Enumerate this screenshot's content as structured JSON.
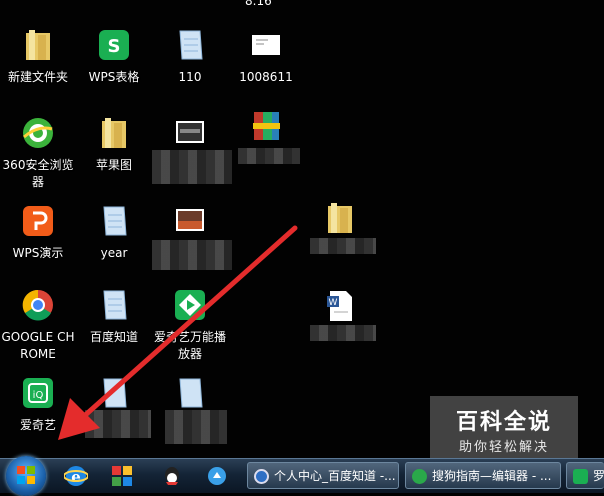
{
  "desktop": {
    "top_partial_label": "8.16",
    "icons": [
      {
        "label": "新建文件夹",
        "icon": "folder-icon"
      },
      {
        "label": "WPS表格",
        "icon": "wps-spreadsheet-icon"
      },
      {
        "label": "110",
        "icon": "notepad-icon"
      },
      {
        "label": "1008611",
        "icon": "document-icon"
      },
      {
        "label": "360安全浏览器",
        "icon": "browser-360-icon"
      },
      {
        "label": "苹果图",
        "icon": "folder-icon"
      },
      {
        "label": "WPS演示",
        "icon": "wps-presentation-icon"
      },
      {
        "label": "year",
        "icon": "notepad-icon"
      },
      {
        "label": "GOOGLE CHROME",
        "icon": "chrome-icon"
      },
      {
        "label": "百度知道",
        "icon": "notepad-icon"
      },
      {
        "label": "爱奇艺万能播放器",
        "icon": "iqiyi-player-icon"
      },
      {
        "label": "爱奇艺",
        "icon": "iqiyi-icon"
      }
    ]
  },
  "taskbar": {
    "tasks": [
      {
        "label": "个人中心_百度知道 -..."
      },
      {
        "label": "搜狗指南—编辑器 - ..."
      },
      {
        "label": "罗"
      }
    ]
  },
  "watermark": {
    "title": "百科全说",
    "subtitle": "助你轻松解决"
  },
  "colors": {
    "arrow": "#e42c2c",
    "taskbar": "#142436",
    "accent_green": "#1aaf52",
    "accent_orange": "#f25c19"
  }
}
